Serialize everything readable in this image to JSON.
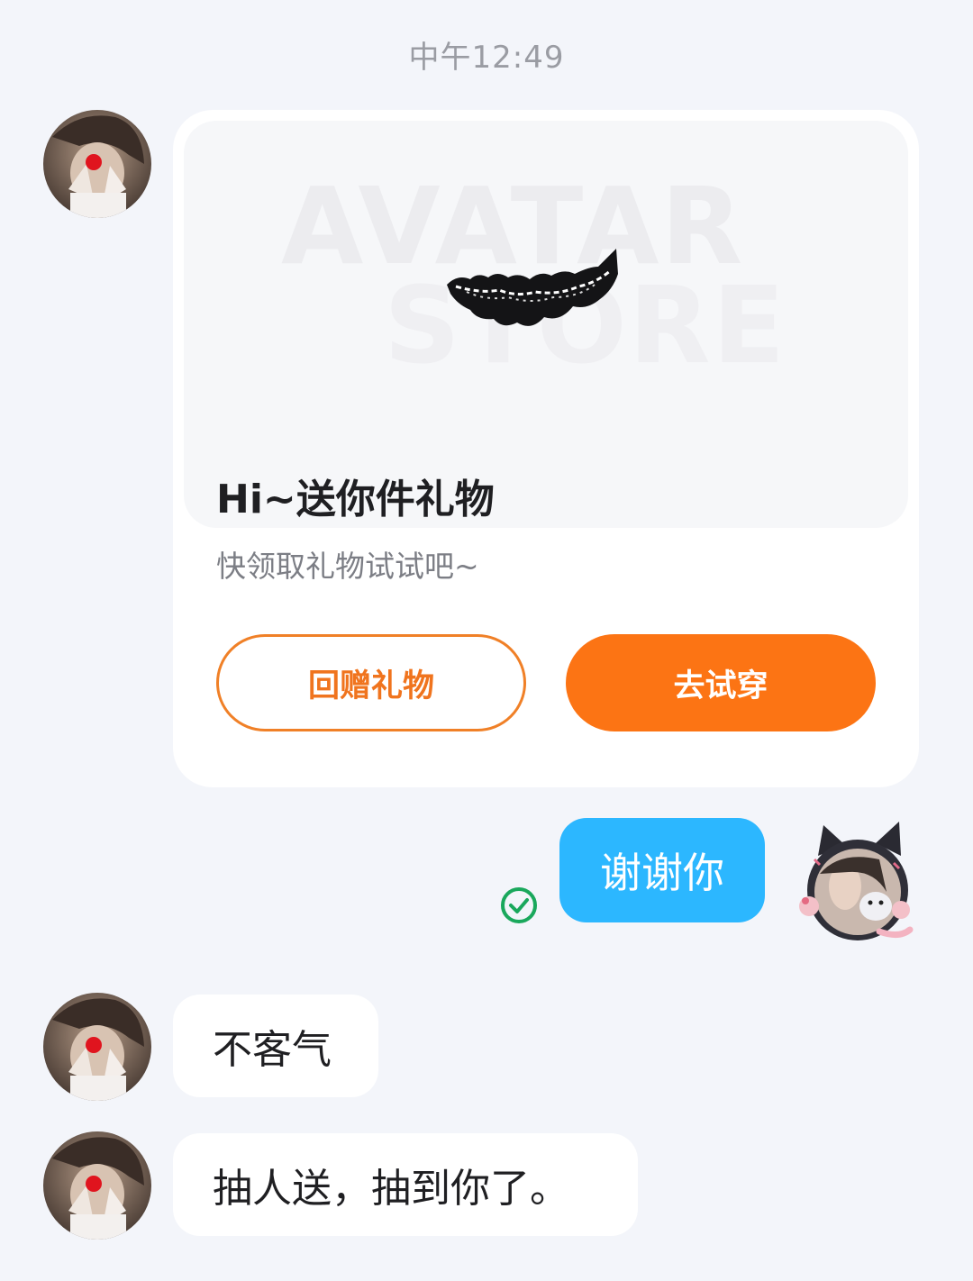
{
  "timestamp": "中午12:49",
  "gift_card": {
    "watermark_line1": "AVATAR",
    "watermark_line2": "STORE",
    "title": "Hi~送你件礼物",
    "subtitle": "快领取礼物试试吧~",
    "return_gift_label": "回赠礼物",
    "try_on_label": "去试穿"
  },
  "messages": [
    {
      "from": "me",
      "text": "谢谢你",
      "status_icon": "check-circle-icon"
    },
    {
      "from": "other",
      "text": "不客气"
    },
    {
      "from": "other",
      "text": "抽人送，抽到你了。"
    }
  ],
  "colors": {
    "background": "#f3f5fa",
    "accent_orange": "#fc7414",
    "outgoing_bubble": "#2cb7ff",
    "read_check": "#1aa85c"
  }
}
